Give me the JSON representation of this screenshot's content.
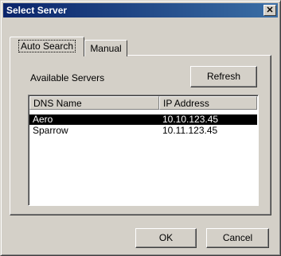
{
  "window": {
    "title": "Select Server",
    "close_glyph": "✕"
  },
  "tabs": [
    {
      "label": "Auto Search",
      "active": true
    },
    {
      "label": "Manual",
      "active": false
    }
  ],
  "panel": {
    "available_label": "Available Servers",
    "refresh_label": "Refresh"
  },
  "list": {
    "columns": [
      "DNS Name",
      "IP Address"
    ],
    "rows": [
      {
        "name": "Aero",
        "ip": "10.10.123.45",
        "selected": true
      },
      {
        "name": "Sparrow",
        "ip": "10.11.123.45",
        "selected": false
      }
    ]
  },
  "footer": {
    "ok_label": "OK",
    "cancel_label": "Cancel"
  },
  "colors": {
    "titlebar": "#0a246a",
    "face": "#d4d0c8",
    "selection": "#000000"
  }
}
